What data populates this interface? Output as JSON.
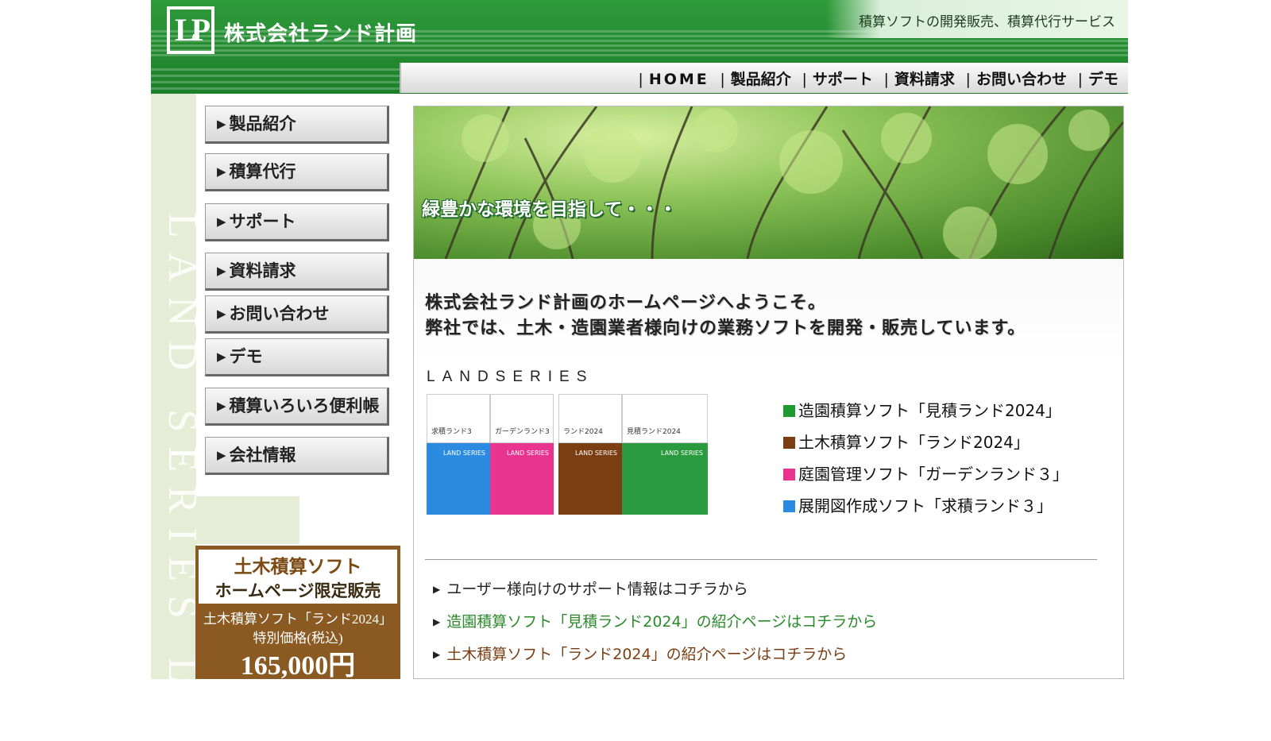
{
  "header": {
    "logo_text": "LP",
    "company_name": "株式会社ランド計画",
    "tagline": "積算ソフトの開発販売、積算代行サービス",
    "nav": [
      "HOME",
      "製品紹介",
      "サポート",
      "資料請求",
      "お問い合わせ",
      "デモ"
    ]
  },
  "sidebar": {
    "vertical_text": "LAND SERIES LA",
    "menu": [
      "製品紹介",
      "積算代行",
      "サポート",
      "資料請求",
      "お問い合わせ",
      "デモ",
      "積算いろいろ便利帳",
      "会社情報"
    ],
    "promo": {
      "line1": "土木積算ソフト",
      "line2": "ホームページ限定販売",
      "line3": "土木積算ソフト「ランド2024」",
      "line4": "特別価格(税込)",
      "price": "165,000円"
    }
  },
  "main": {
    "hero_caption": "緑豊かな環境を目指して・・・",
    "welcome_line1": "株式会社ランド計画のホームページへようこそ。",
    "welcome_line2": "弊社では、土木・造園業者様向けの業務ソフトを開発・販売しています。",
    "series_title": "LANDSERIES",
    "boxes": [
      {
        "label": "求積ランド3",
        "color": "#2b8be0"
      },
      {
        "label": "ガーデンランド3",
        "color": "#e8338f"
      },
      {
        "label": "ランド2024",
        "color": "#7a3e12"
      },
      {
        "label": "見積ランド2024",
        "color": "#2a9a3e"
      }
    ],
    "box_brand": "LAND SERIES",
    "products": [
      {
        "text": "造園積算ソフト「見積ランド2024」",
        "color": "#1f9a2e"
      },
      {
        "text": "土木積算ソフト「ランド2024」",
        "color": "#7a3e12"
      },
      {
        "text": "庭園管理ソフト「ガーデンランド３」",
        "color": "#e8338f"
      },
      {
        "text": "展開図作成ソフト「求積ランド３」",
        "color": "#2b8be0"
      }
    ],
    "links": [
      {
        "text": "ユーザー様向けのサポート情報はコチラから",
        "color": "#222222"
      },
      {
        "text": "造園積算ソフト「見積ランド2024」の紹介ページはコチラから",
        "color": "#2a8a2a"
      },
      {
        "text": "土木積算ソフト「ランド2024」の紹介ページはコチラから",
        "color": "#7a3e12"
      }
    ]
  },
  "colors": {
    "header_green": "#2e9a3a",
    "sidebar_bg": "#e6edd6",
    "promo_brown": "#8a5a22"
  }
}
